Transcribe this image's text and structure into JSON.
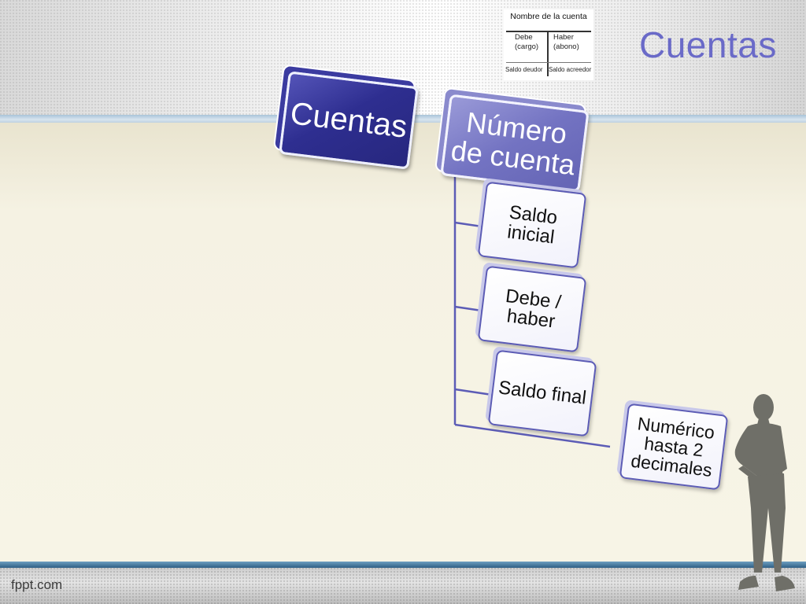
{
  "slide": {
    "title": "Cuentas",
    "footer": "fppt.com"
  },
  "t_account": {
    "name": "Nombre de la cuenta",
    "left_1": "Debe",
    "left_2": "(cargo)",
    "right_1": "Haber",
    "right_2": "(abono)",
    "bottom_left": "Saldo deudor",
    "bottom_right": "Saldo acreedor"
  },
  "diagram": {
    "root": "Cuentas",
    "level1": "Número de cuenta",
    "level1_line1": "Número",
    "level1_line2": "de cuenta",
    "children": [
      {
        "line1": "Saldo",
        "line2": "inicial"
      },
      {
        "line1": "Debe /",
        "line2": "haber"
      },
      {
        "line1": "Saldo final",
        "line2": ""
      },
      {
        "line1": "Numérico",
        "line2": "hasta 2",
        "line3": "decimales"
      }
    ]
  },
  "colors": {
    "title": "#6a6ac8",
    "root_block": "#2e2e90",
    "level1_block": "#7373c2",
    "child_border": "#5c5cb6",
    "connector": "#5c5cb6"
  }
}
